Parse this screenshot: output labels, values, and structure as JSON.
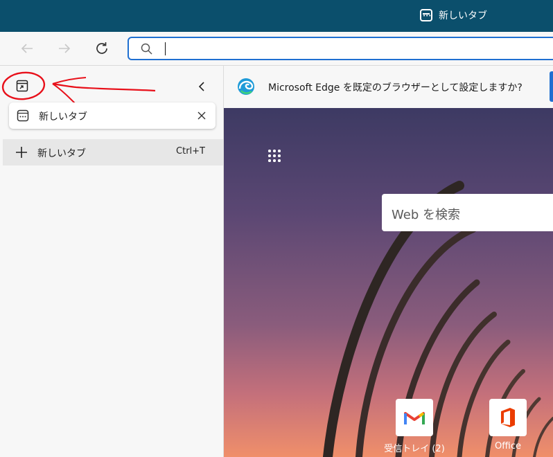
{
  "titlebar": {
    "active_tab_title": "新しいタブ"
  },
  "toolbar": {
    "address_value": ""
  },
  "sidebar": {
    "tab_item": {
      "label": "新しいタブ"
    },
    "new_tab": {
      "label": "新しいタブ",
      "shortcut": "Ctrl+T"
    }
  },
  "banner": {
    "text": "Microsoft Edge を既定のブラウザーとして設定しますか?"
  },
  "newtab_page": {
    "search_placeholder": "Web を検索",
    "quick_links": [
      {
        "label": "受信トレイ (2)",
        "icon": "gmail-icon"
      },
      {
        "label": "Office",
        "icon": "office-icon"
      }
    ]
  },
  "colors": {
    "titlebar": "#0b4f6c",
    "accent": "#1f6fd1",
    "annotation": "#e8101a"
  }
}
